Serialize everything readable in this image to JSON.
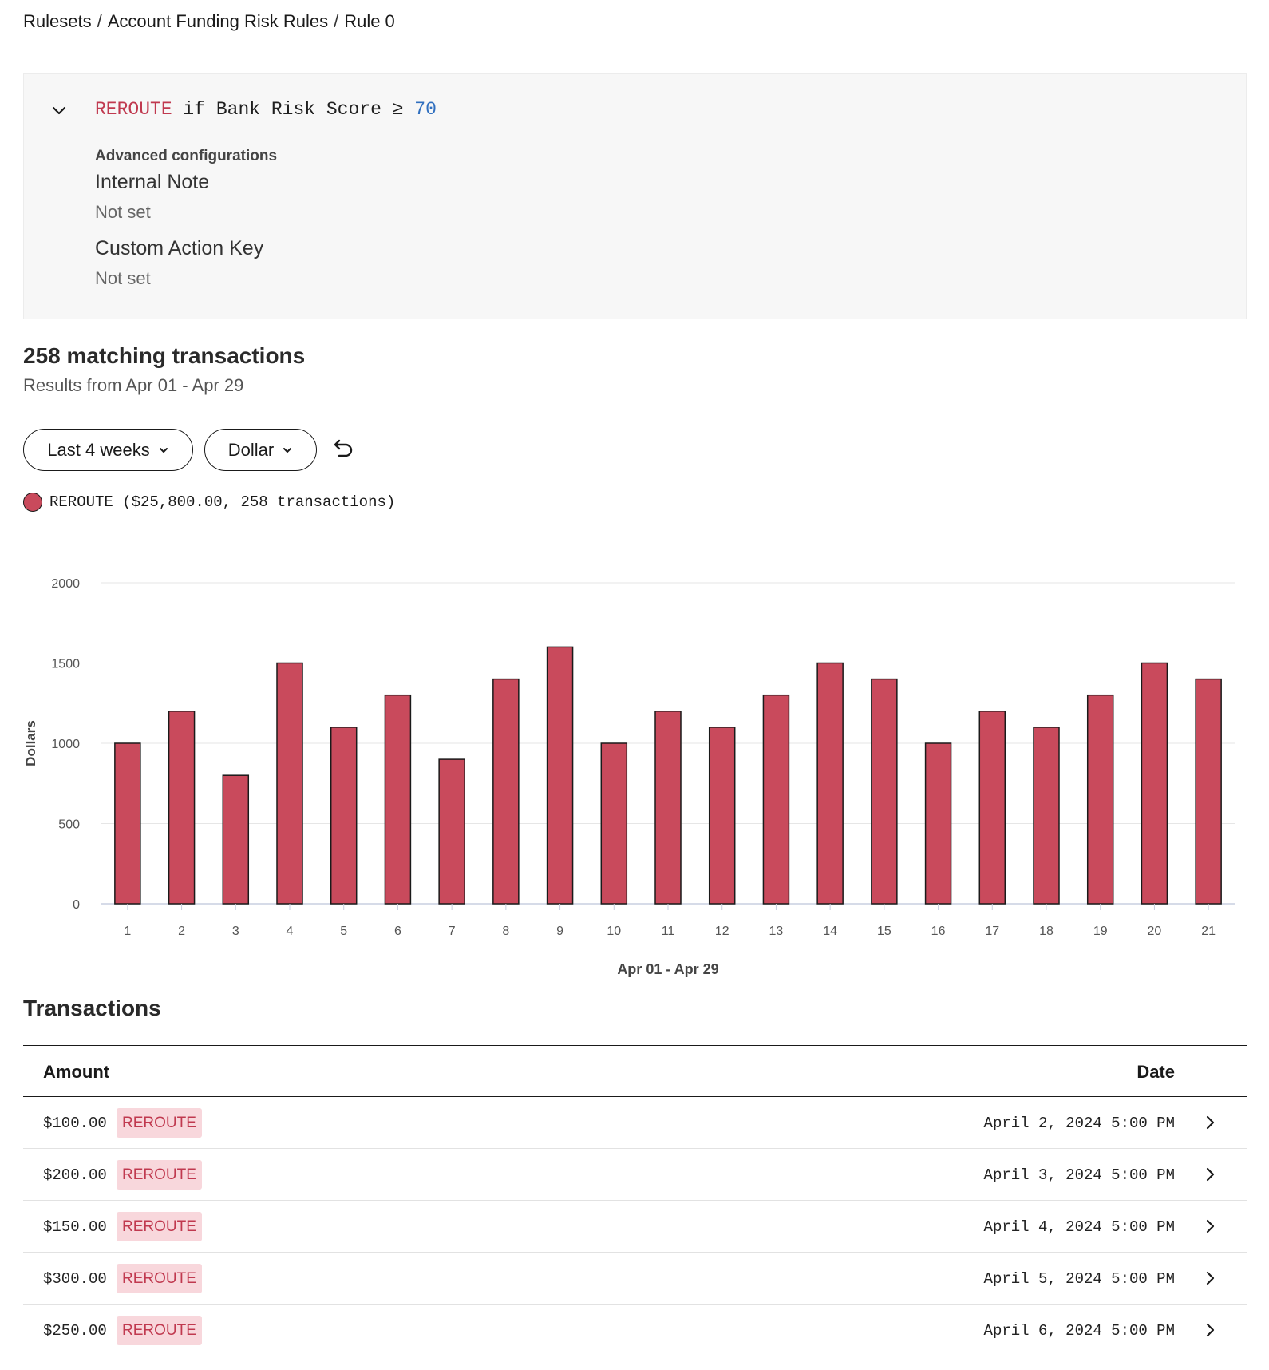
{
  "breadcrumb": {
    "items": [
      "Rulesets",
      "Account Funding Risk Rules",
      "Rule 0"
    ],
    "separator": "/"
  },
  "rule": {
    "action": "REROUTE",
    "condition_prefix": " if Bank Risk Score ≥ ",
    "threshold": "70",
    "advanced_title": "Advanced configurations",
    "internal_note_label": "Internal Note",
    "internal_note_value": "Not set",
    "custom_action_label": "Custom Action Key",
    "custom_action_value": "Not set"
  },
  "summary": {
    "title": "258 matching transactions",
    "subtitle": "Results from Apr 01 - Apr 29"
  },
  "filters": {
    "range_label": "Last 4 weeks",
    "unit_label": "Dollar"
  },
  "legend": {
    "label": "REROUTE ($25,800.00, 258 transactions)",
    "color": "#c94a5c"
  },
  "chart_data": {
    "type": "bar",
    "categories": [
      "1",
      "2",
      "3",
      "4",
      "5",
      "6",
      "7",
      "8",
      "9",
      "10",
      "11",
      "12",
      "13",
      "14",
      "15",
      "16",
      "17",
      "18",
      "19",
      "20",
      "21"
    ],
    "series": [
      {
        "name": "REROUTE",
        "values": [
          1000,
          1200,
          800,
          1500,
          1100,
          1300,
          900,
          1400,
          1600,
          1000,
          1200,
          1100,
          1300,
          1500,
          1400,
          1000,
          1200,
          1100,
          1300,
          1500,
          1400
        ]
      }
    ],
    "yticks": [
      0,
      500,
      1000,
      1500,
      2000
    ],
    "ylim": [
      0,
      2000
    ],
    "ylabel": "Dollars",
    "xlabel": "Apr 01 - Apr 29",
    "grid": true,
    "bar_color": "#c94a5c"
  },
  "transactions": {
    "title": "Transactions",
    "col_amount": "Amount",
    "col_date": "Date",
    "rows": [
      {
        "amount": "$100.00",
        "badge": "REROUTE",
        "date": "April 2, 2024 5:00 PM"
      },
      {
        "amount": "$200.00",
        "badge": "REROUTE",
        "date": "April 3, 2024 5:00 PM"
      },
      {
        "amount": "$150.00",
        "badge": "REROUTE",
        "date": "April 4, 2024 5:00 PM"
      },
      {
        "amount": "$300.00",
        "badge": "REROUTE",
        "date": "April 5, 2024 5:00 PM"
      },
      {
        "amount": "$250.00",
        "badge": "REROUTE",
        "date": "April 6, 2024 5:00 PM"
      }
    ]
  }
}
